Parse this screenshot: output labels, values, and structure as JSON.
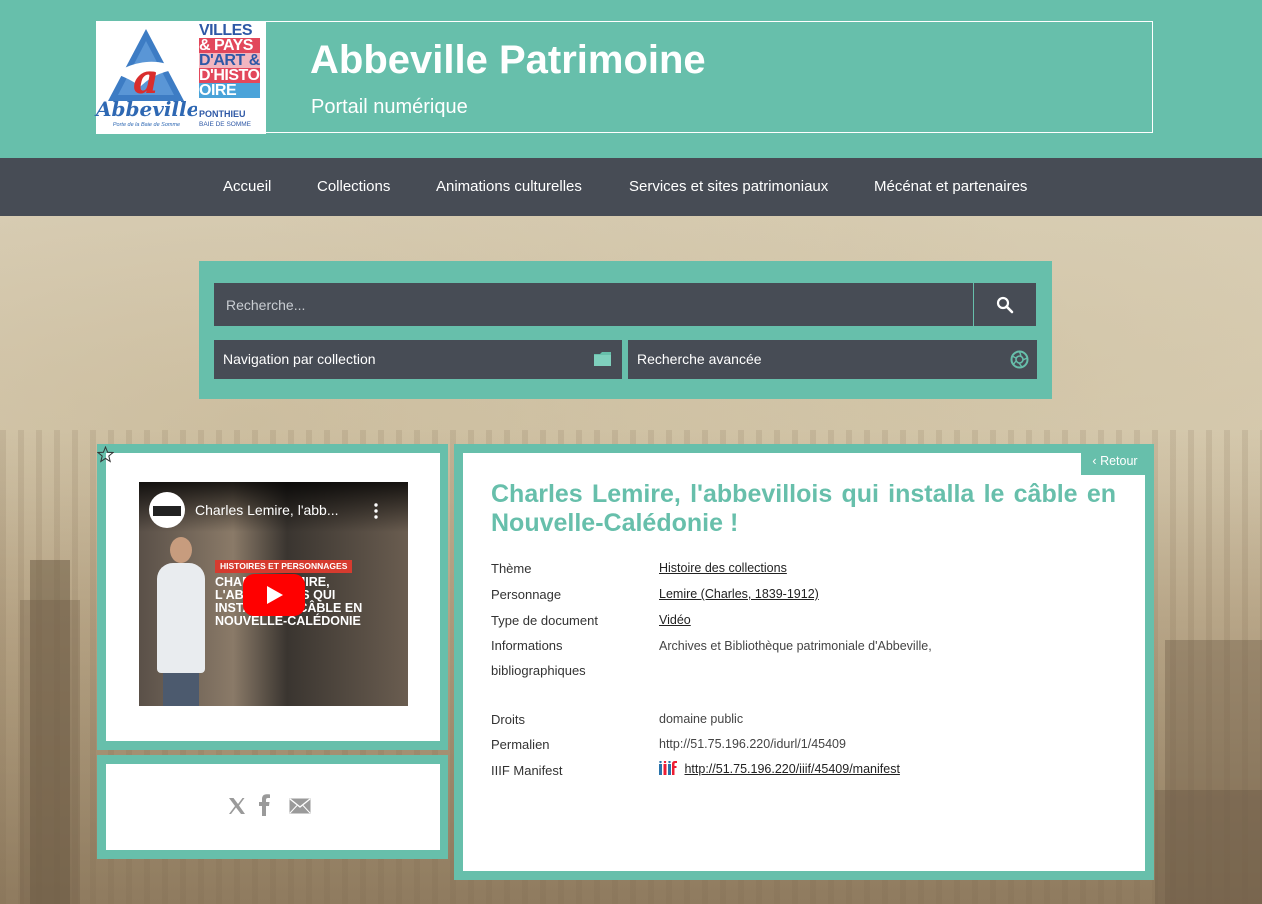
{
  "header": {
    "title": "Abbeville Patrimoine",
    "subtitle": "Portail numérique",
    "logo_city_text": "Abbeville",
    "logo_city_tagline": "Porte de la Baie de Somme",
    "logo_vpah_lines": [
      "VILLES",
      "& PAYS",
      "D'ART &",
      "D'HISTO",
      "OIRE",
      "PONTHIEU",
      "BAIE DE SOMME"
    ]
  },
  "nav": {
    "items": [
      {
        "label": "Accueil"
      },
      {
        "label": "Collections"
      },
      {
        "label": "Animations culturelles"
      },
      {
        "label": "Services et sites patrimoniaux"
      },
      {
        "label": "Mécénat et partenaires"
      }
    ]
  },
  "search": {
    "placeholder": "Recherche...",
    "collection_nav_label": "Navigation par collection",
    "advanced_label": "Recherche avancée"
  },
  "video": {
    "title": "Charles Lemire, l'abb...",
    "banner": "HISTOIRES ET PERSONNAGES",
    "overlay_lines": [
      "CHARLES LEMIRE,",
      "L'ABBEVILLOIS QUI",
      "INSTALLA LE CÂBLE EN",
      "NOUVELLE-CALÉDONIE"
    ]
  },
  "detail": {
    "back_label": "Retour",
    "title": "Charles Lemire, l'abbevillois qui installa le câble en Nouvelle-Calédonie !",
    "fields": [
      {
        "label": "Thème",
        "value": "Histoire des collections",
        "link": true
      },
      {
        "label": "Personnage",
        "value": "Lemire (Charles, 1839-1912)",
        "link": true
      },
      {
        "label": "Type de document",
        "value": "Vidéo",
        "link": true
      },
      {
        "label": "Informations bibliographiques",
        "value": "Archives et Bibliothèque patrimoniale d'Abbeville,",
        "link": false
      },
      {
        "label": "Droits",
        "value": "domaine public",
        "link": false
      },
      {
        "label": "Permalien",
        "value": "http://51.75.196.220/idurl/1/45409",
        "link": false
      },
      {
        "label": "IIIF Manifest",
        "value": "http://51.75.196.220/iiif/45409/manifest",
        "link": true
      }
    ]
  },
  "colors": {
    "teal": "#67bfab",
    "dark": "#474c55"
  }
}
